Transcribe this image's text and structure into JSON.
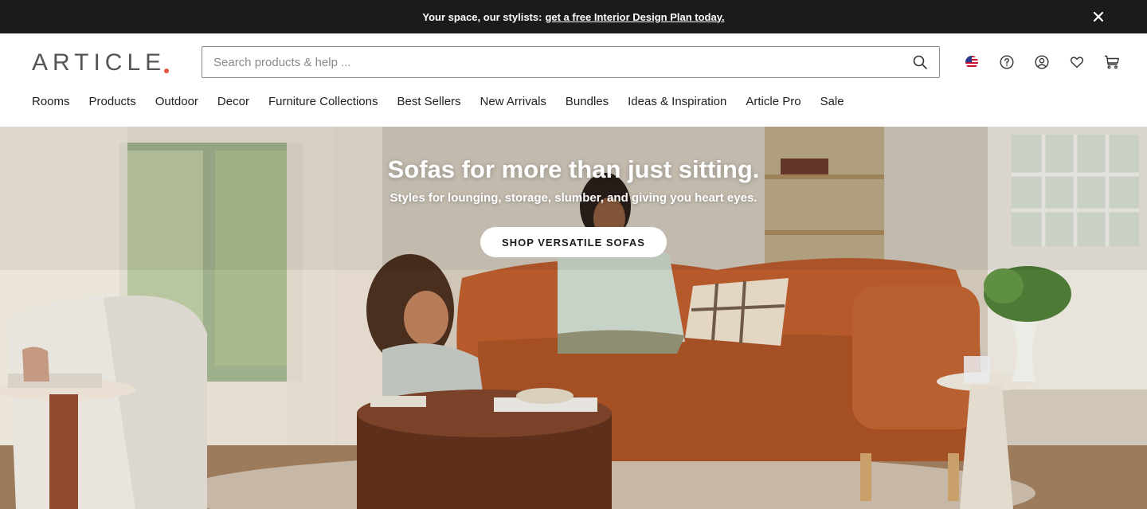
{
  "promo": {
    "text": "Your space, our stylists:",
    "link": "get a free Interior Design Plan today.",
    "close_icon": "close-icon"
  },
  "header": {
    "logo_text": "ARTICLE",
    "logo_dot_color": "#e2553f",
    "search": {
      "placeholder": "Search products & help ...",
      "value": "",
      "icon": "search-icon"
    },
    "icons": [
      "us-flag-icon",
      "help-icon",
      "account-icon",
      "heart-icon",
      "cart-icon"
    ]
  },
  "nav": {
    "items": [
      {
        "label": "Rooms"
      },
      {
        "label": "Products"
      },
      {
        "label": "Outdoor"
      },
      {
        "label": "Decor"
      },
      {
        "label": "Furniture Collections"
      },
      {
        "label": "Best Sellers"
      },
      {
        "label": "New Arrivals"
      },
      {
        "label": "Bundles"
      },
      {
        "label": "Ideas & Inspiration"
      },
      {
        "label": "Article Pro"
      },
      {
        "label": "Sale"
      }
    ]
  },
  "hero": {
    "title": "Sofas for more than just sitting.",
    "subtitle": "Styles for lounging, storage, slumber, and giving you heart eyes.",
    "cta_label": "SHOP VERSATILE SOFAS",
    "sofa_color": "#b65a2c"
  }
}
